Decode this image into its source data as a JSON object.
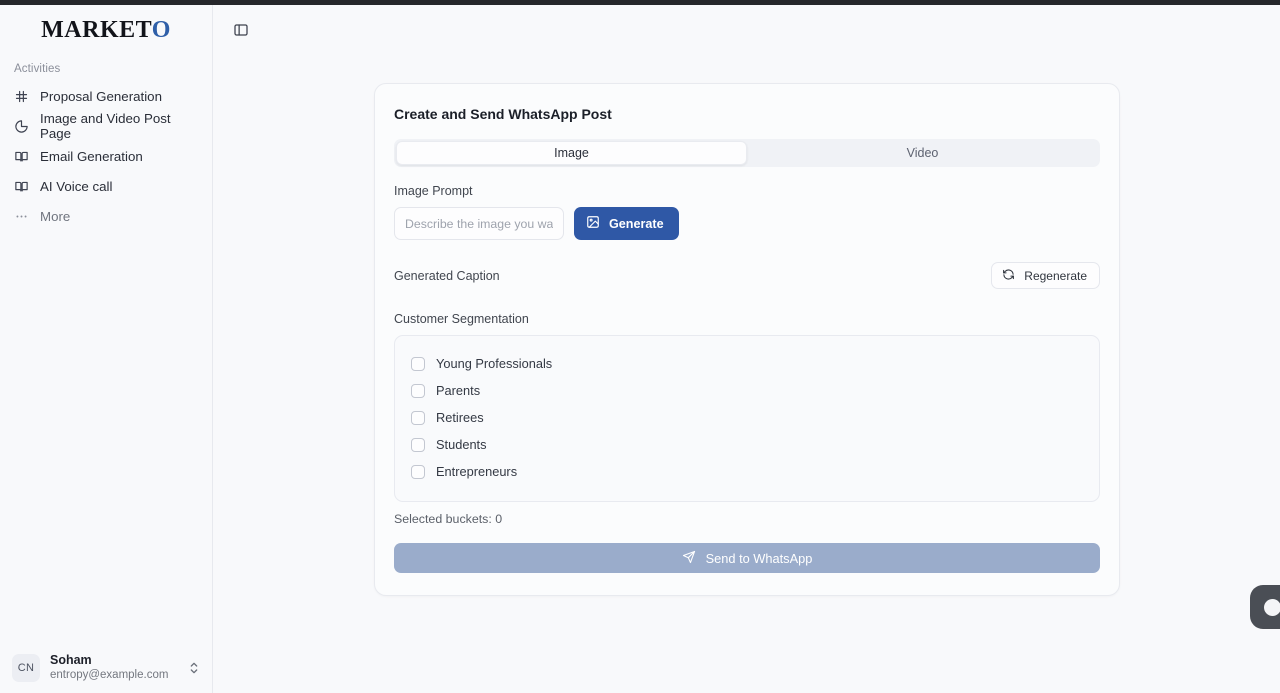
{
  "brand": {
    "name_main": "MARKET",
    "name_accent": "O"
  },
  "sidebar": {
    "section_label": "Activities",
    "items": [
      {
        "label": "Proposal Generation",
        "icon": "frame-icon"
      },
      {
        "label": "Image and Video Post Page",
        "icon": "pie-chart-icon"
      },
      {
        "label": "Email Generation",
        "icon": "book-icon"
      },
      {
        "label": "AI Voice call",
        "icon": "book-icon"
      },
      {
        "label": "More",
        "icon": "ellipsis-icon"
      }
    ],
    "user": {
      "initials": "CN",
      "name": "Soham",
      "email": "entropy@example.com"
    }
  },
  "topbar": {
    "toggle_icon": "sidebar-toggle-icon"
  },
  "card": {
    "title": "Create and Send WhatsApp Post",
    "tabs": [
      {
        "label": "Image",
        "active": true
      },
      {
        "label": "Video",
        "active": false
      }
    ],
    "prompt": {
      "label": "Image Prompt",
      "placeholder": "Describe the image you want",
      "value": "",
      "generate_label": "Generate",
      "generate_icon": "image-icon"
    },
    "caption": {
      "label": "Generated Caption",
      "regenerate_label": "Regenerate",
      "regenerate_icon": "refresh-icon"
    },
    "segmentation": {
      "label": "Customer Segmentation",
      "options": [
        {
          "label": "Young Professionals",
          "checked": false
        },
        {
          "label": "Parents",
          "checked": false
        },
        {
          "label": "Retirees",
          "checked": false
        },
        {
          "label": "Students",
          "checked": false
        },
        {
          "label": "Entrepreneurs",
          "checked": false
        }
      ],
      "selected_text": "Selected buckets: 0"
    },
    "send": {
      "label": "Send to WhatsApp",
      "icon": "send-icon",
      "disabled": true
    }
  },
  "floating": {
    "widget_icon": "chat-bubble-icon"
  },
  "colors": {
    "accent_blue": "#2f58a6",
    "logo_accent": "#2f5fa8",
    "send_disabled": "#9aaccb",
    "page_bg": "#f8f9fb",
    "topstrip": "#26272b"
  }
}
